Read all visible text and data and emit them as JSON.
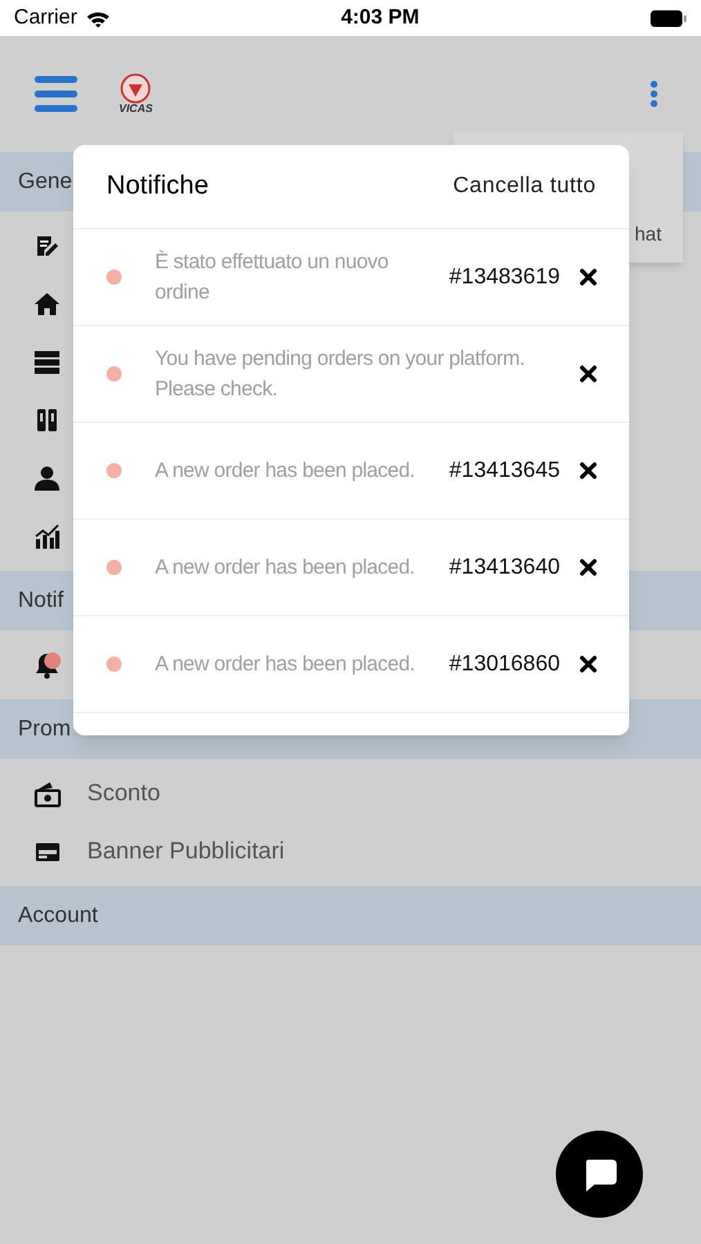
{
  "status_bar": {
    "carrier": "Carrier",
    "time": "4:03 PM"
  },
  "header": {
    "logo_text": "VICAS"
  },
  "sidebar": [
    {
      "title": "Gene",
      "items": [
        {
          "kind": "edit"
        },
        {
          "kind": "home"
        },
        {
          "kind": "server"
        },
        {
          "kind": "book"
        },
        {
          "kind": "person"
        },
        {
          "kind": "chart"
        }
      ]
    },
    {
      "title": "Notif",
      "items": [
        {
          "kind": "bell",
          "badge": true
        }
      ]
    },
    {
      "title": "Prom",
      "items": [
        {
          "kind": "money",
          "label": "Sconto"
        },
        {
          "kind": "banner",
          "label": "Banner Pubblicitari"
        }
      ]
    },
    {
      "title": "Account"
    }
  ],
  "options_menu": {
    "item": "hat"
  },
  "notifications": {
    "title": "Notifiche",
    "clear_all": "Cancella tutto",
    "items": [
      {
        "message": "È stato effettuato un nuovo ordine",
        "order": "#13483619",
        "unread": true
      },
      {
        "message": "You have pending orders on your platform. Please check.",
        "unread": true
      },
      {
        "message": "A new order has been placed.",
        "order": "#13413645",
        "unread": true
      },
      {
        "message": "A new order has been placed.",
        "order": "#13413640",
        "unread": true
      },
      {
        "message": "A new order has been placed.",
        "order": "#13016860",
        "unread": true
      }
    ]
  }
}
